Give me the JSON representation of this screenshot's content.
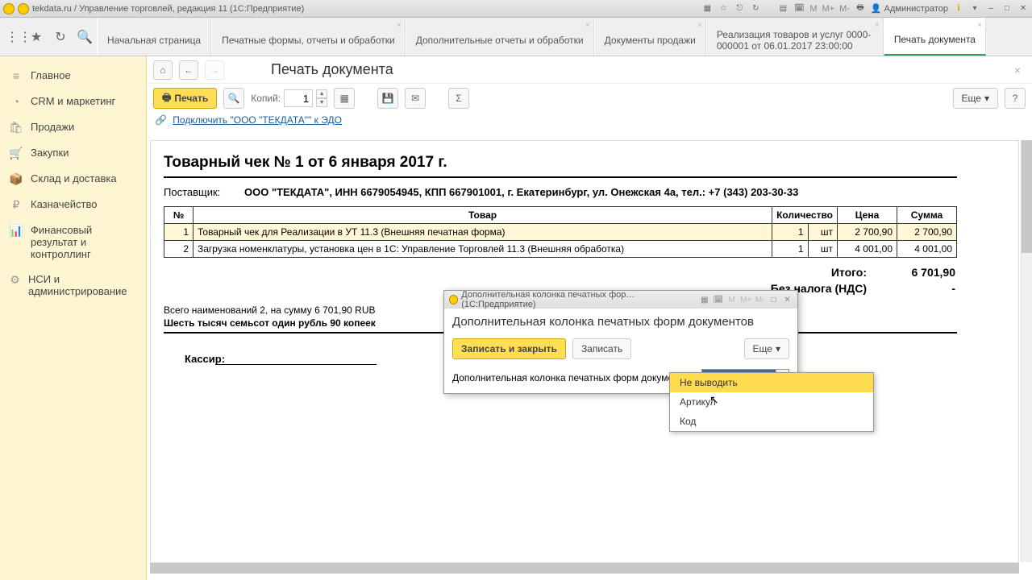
{
  "titlebar": {
    "title": "tekdata.ru / Управление торговлей, редакция 11 (1С:Предприятие)",
    "user": "Администратор",
    "m_labels": [
      "M",
      "M+",
      "M-"
    ]
  },
  "tabs": [
    {
      "label": "Начальная страница"
    },
    {
      "label": "Печатные формы, отчеты и обработки"
    },
    {
      "label": "Дополнительные отчеты и обработки"
    },
    {
      "label": "Документы продажи"
    },
    {
      "label": "Реализация товаров и услуг 0000-000001 от 06.01.2017 23:00:00"
    },
    {
      "label": "Печать документа",
      "active": true
    }
  ],
  "sidebar": {
    "items": [
      {
        "label": "Главное",
        "icon": "≡"
      },
      {
        "label": "CRM и маркетинг",
        "icon": "◔"
      },
      {
        "label": "Продажи",
        "icon": "🛍"
      },
      {
        "label": "Закупки",
        "icon": "🛒"
      },
      {
        "label": "Склад и доставка",
        "icon": "📦"
      },
      {
        "label": "Казначейство",
        "icon": "₽"
      },
      {
        "label": "Финансовый результат и контроллинг",
        "icon": "📊"
      },
      {
        "label": "НСИ и администрирование",
        "icon": "⚙"
      }
    ]
  },
  "page": {
    "title": "Печать документа",
    "print": "Печать",
    "copies_label": "Копий:",
    "copies_value": "1",
    "more": "Еще",
    "help": "?",
    "edo_link": "Подключить \"ООО \"ТЕКДАТА\"\" к ЭДО"
  },
  "document": {
    "heading": "Товарный чек № 1 от 6 января 2017 г.",
    "supplier_label": "Поставщик:",
    "supplier": "ООО \"ТЕКДАТА\", ИНН 6679054945, КПП 667901001, г. Екатеринбург, ул. Онежская 4а, тел.: +7 (343) 203-30-33",
    "columns": {
      "num": "№",
      "name": "Товар",
      "qty": "Количество",
      "price": "Цена",
      "sum": "Сумма"
    },
    "rows": [
      {
        "num": "1",
        "name": "Товарный чек для Реализации в УТ 11.3 (Внешняя печатная форма)",
        "qty": "1",
        "unit": "шт",
        "price": "2 700,90",
        "sum": "2 700,90",
        "hilite": true
      },
      {
        "num": "2",
        "name": "Загрузка номенклатуры, установка цен в 1С: Управление Торговлей 11.3 (Внешняя обработка)",
        "qty": "1",
        "unit": "шт",
        "price": "4 001,00",
        "sum": "4 001,00"
      }
    ],
    "total_label": "Итого:",
    "total": "6 701,90",
    "tax_label": "Без налога (НДС)",
    "tax": "-",
    "summary": "Всего наименований 2, на сумму 6 701,90 RUB",
    "words": "Шесть тысяч семьсот один рубль 90 копеек",
    "cashier_label": "Кассир:"
  },
  "modal": {
    "title": "Дополнительная колонка печатных фор…  (1С:Предприятие)",
    "heading": "Дополнительная колонка печатных форм документов",
    "save_close": "Записать и закрыть",
    "save": "Записать",
    "more": "Еще",
    "field_label": "Дополнительная колонка печатных форм документов:",
    "value": "Не выводить",
    "options": [
      "Не выводить",
      "Артикул",
      "Код"
    ]
  }
}
